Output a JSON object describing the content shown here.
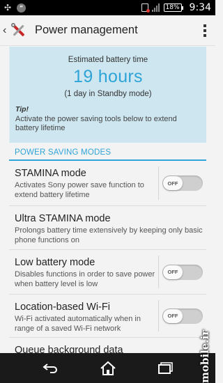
{
  "status_bar": {
    "battery_level": "18%",
    "time": "9:34"
  },
  "action_bar": {
    "title": "Power management"
  },
  "battery_card": {
    "estimate_label": "Estimated battery time",
    "estimate_hours": "19 hours",
    "standby": "(1 day in Standby mode)",
    "tip_label": "Tip!",
    "tip_text": "Activate the power saving tools below to extend battery lifetime"
  },
  "section": {
    "header": "POWER SAVING MODES"
  },
  "modes": [
    {
      "title": "STAMINA mode",
      "subtitle": "Activates Sony power save function to extend battery lifetime",
      "toggle": "OFF"
    },
    {
      "title": "Ultra STAMINA mode",
      "subtitle": "Prolongs battery time extensively by keeping only basic phone functions on"
    },
    {
      "title": "Low battery mode",
      "subtitle": "Disables functions in order to save power when battery level is low",
      "toggle": "OFF"
    },
    {
      "title": "Location-based Wi-Fi",
      "subtitle": "Wi-Fi activated automatically when in range of a saved Wi-Fi network",
      "toggle": "OFF"
    },
    {
      "title": "Queue background data"
    }
  ],
  "watermark": "mobile.ir",
  "colors": {
    "accent": "#2ea4d8",
    "card_background": "#cde6ef"
  }
}
